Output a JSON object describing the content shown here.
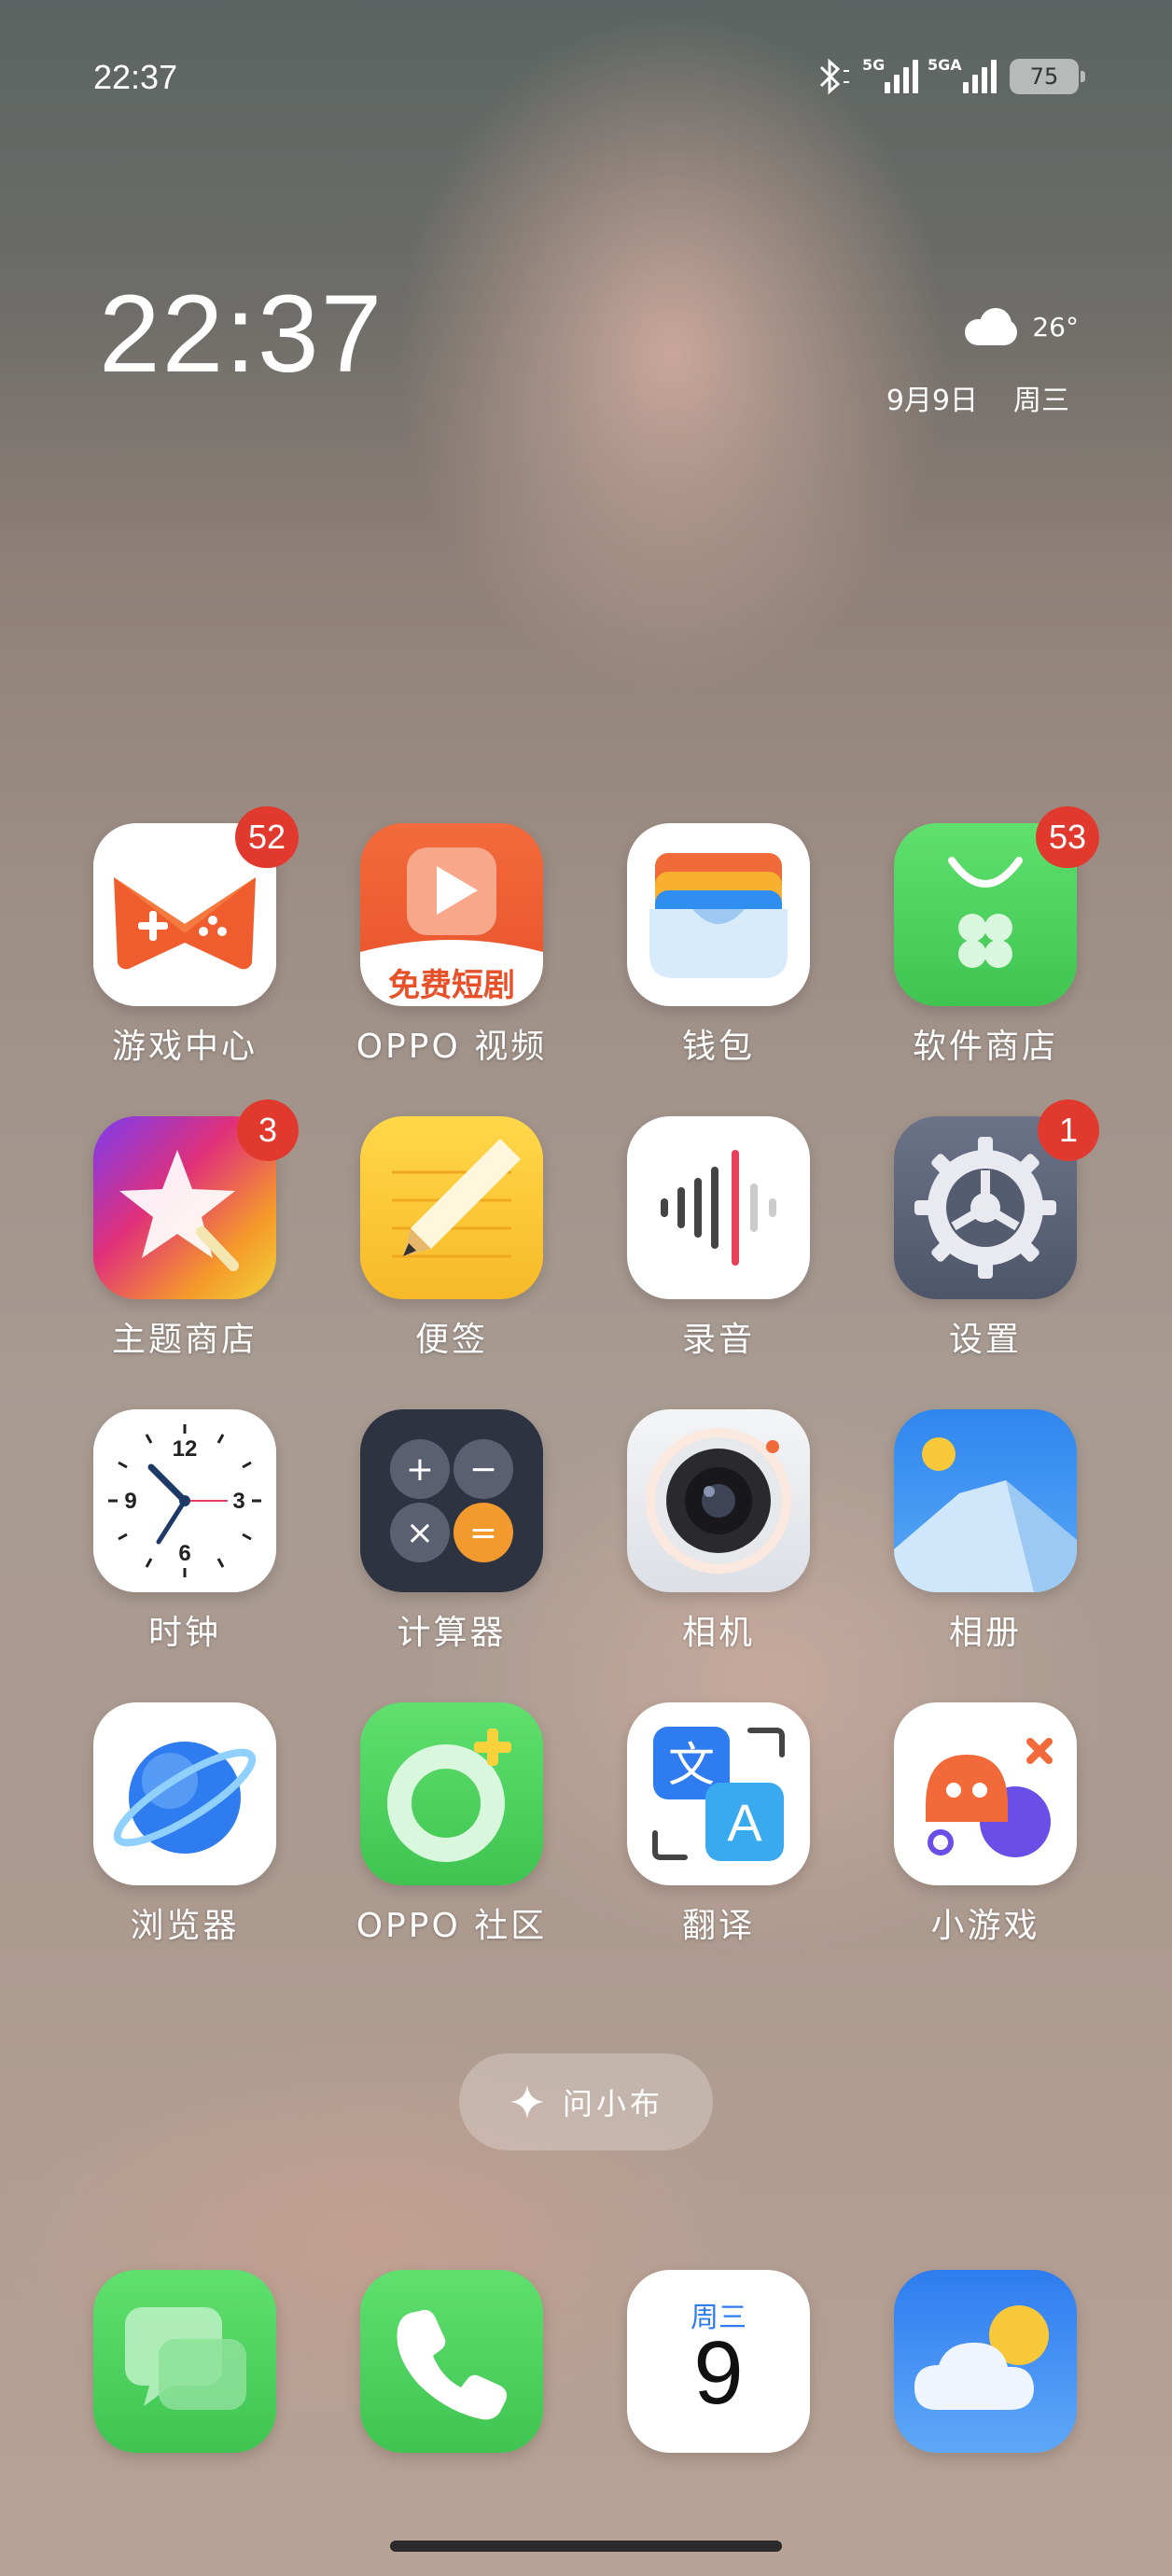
{
  "status_bar": {
    "time": "22:37",
    "signal1_label": "5G",
    "signal2_label": "5GA",
    "battery": "75"
  },
  "clock_widget": {
    "time": "22:37",
    "temperature": "26°",
    "date": "9月9日",
    "weekday": "周三"
  },
  "apps": [
    {
      "label": "游戏中心",
      "badge": "52",
      "icon": "game-controller-icon"
    },
    {
      "label": "OPPO 视频",
      "badge": "",
      "icon": "video-play-icon",
      "sub_text": "免费短剧"
    },
    {
      "label": "钱包",
      "badge": "",
      "icon": "wallet-icon"
    },
    {
      "label": "软件商店",
      "badge": "53",
      "icon": "app-store-icon"
    },
    {
      "label": "主题商店",
      "badge": "3",
      "icon": "star-theme-icon"
    },
    {
      "label": "便签",
      "badge": "",
      "icon": "note-pencil-icon"
    },
    {
      "label": "录音",
      "badge": "",
      "icon": "audio-wave-icon"
    },
    {
      "label": "设置",
      "badge": "1",
      "icon": "gear-icon"
    },
    {
      "label": "时钟",
      "badge": "",
      "icon": "clock-face-icon",
      "clock_numbers": [
        "12",
        "3",
        "6",
        "9"
      ]
    },
    {
      "label": "计算器",
      "badge": "",
      "icon": "calculator-icon",
      "keys": [
        "+",
        "−",
        "×",
        "="
      ]
    },
    {
      "label": "相机",
      "badge": "",
      "icon": "camera-lens-icon"
    },
    {
      "label": "相册",
      "badge": "",
      "icon": "photo-mountain-icon"
    },
    {
      "label": "浏览器",
      "badge": "",
      "icon": "planet-browser-icon"
    },
    {
      "label": "OPPO 社区",
      "badge": "",
      "icon": "community-ring-icon"
    },
    {
      "label": "翻译",
      "badge": "",
      "icon": "translate-icon",
      "glyph_a": "文",
      "glyph_b": "A"
    },
    {
      "label": "小游戏",
      "badge": "",
      "icon": "mini-game-ghost-icon"
    }
  ],
  "ask_button": {
    "label": "问小布"
  },
  "dock": [
    {
      "icon": "messages-icon"
    },
    {
      "icon": "phone-icon"
    },
    {
      "icon": "calendar-icon",
      "weekday": "周三",
      "day": "9"
    },
    {
      "icon": "weather-icon"
    }
  ],
  "colors": {
    "badge": "#e2392f",
    "green": "#4cd763",
    "orange": "#ef5d2e"
  }
}
